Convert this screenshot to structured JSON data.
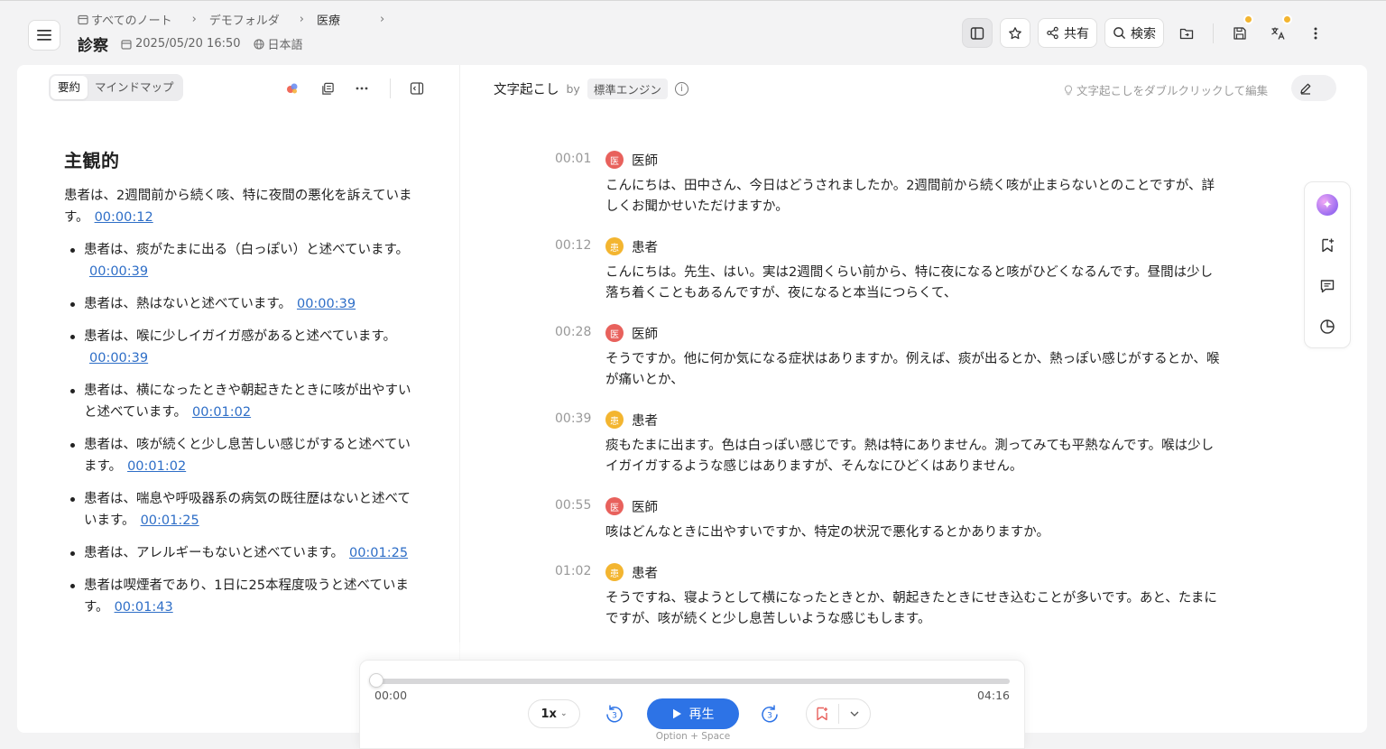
{
  "header": {
    "breadcrumb": [
      "すべてのノート",
      "デモフォルダ",
      "医療"
    ],
    "title": "診察",
    "datetime": "2025/05/20 16:50",
    "language": "日本語",
    "share_label": "共有",
    "search_label": "検索"
  },
  "left_panel": {
    "tabs": [
      "要約",
      "マインドマップ"
    ],
    "active_tab": "要約",
    "section_title": "主観的",
    "intro": {
      "text": "患者は、2週間前から続く咳、特に夜間の悪化を訴えています。",
      "timestamp": "00:00:12"
    },
    "bullets": [
      {
        "text": "患者は、痰がたまに出る（白っぽい）と述べています。",
        "timestamp": "00:00:39"
      },
      {
        "text": "患者は、熱はないと述べています。",
        "timestamp": "00:00:39"
      },
      {
        "text": "患者は、喉に少しイガイガ感があると述べています。",
        "timestamp": "00:00:39"
      },
      {
        "text": "患者は、横になったときや朝起きたときに咳が出やすいと述べています。",
        "timestamp": "00:01:02"
      },
      {
        "text": "患者は、咳が続くと少し息苦しい感じがすると述べています。",
        "timestamp": "00:01:02"
      },
      {
        "text": "患者は、喘息や呼吸器系の病気の既往歴はないと述べています。",
        "timestamp": "00:01:25"
      },
      {
        "text": "患者は、アレルギーもないと述べています。",
        "timestamp": "00:01:25"
      },
      {
        "text": "患者は喫煙者であり、1日に25本程度吸うと述べています。",
        "timestamp": "00:01:43"
      }
    ]
  },
  "transcript": {
    "title": "文字起こし",
    "by": "by",
    "engine": "標準エンジン",
    "hint": "文字起こしをダブルクリックして編集",
    "utterances": [
      {
        "time": "00:01",
        "speaker": "医師",
        "avatar": "医",
        "role": "doctor",
        "text": "こんにちは、田中さん、今日はどうされましたか。2週間前から続く咳が止まらないとのことですが、詳しくお聞かせいただけますか。"
      },
      {
        "time": "00:12",
        "speaker": "患者",
        "avatar": "患",
        "role": "patient",
        "text": "こんにちは。先生、はい。実は2週間くらい前から、特に夜になると咳がひどくなるんです。昼間は少し落ち着くこともあるんですが、夜になると本当につらくて、"
      },
      {
        "time": "00:28",
        "speaker": "医師",
        "avatar": "医",
        "role": "doctor",
        "text": "そうですか。他に何か気になる症状はありますか。例えば、痰が出るとか、熱っぽい感じがするとか、喉が痛いとか、"
      },
      {
        "time": "00:39",
        "speaker": "患者",
        "avatar": "患",
        "role": "patient",
        "text": "痰もたまに出ます。色は白っぽい感じです。熱は特にありません。測ってみても平熱なんです。喉は少しイガイガするような感じはありますが、そんなにひどくはありません。"
      },
      {
        "time": "00:55",
        "speaker": "医師",
        "avatar": "医",
        "role": "doctor",
        "text": "咳はどんなときに出やすいですか、特定の状況で悪化するとかありますか。"
      },
      {
        "time": "01:02",
        "speaker": "患者",
        "avatar": "患",
        "role": "patient",
        "text": "そうですね、寝ようとして横になったときとか、朝起きたときにせき込むことが多いです。あと、たまにですが、咳が続くと少し息苦しいような感じもします。"
      }
    ]
  },
  "player": {
    "current": "00:00",
    "duration": "04:16",
    "progress": 0.0,
    "speed": "1x",
    "skip_back": "3",
    "skip_forward": "3",
    "play_label": "再生",
    "shortcut": "Option + Space"
  },
  "colors": {
    "accent": "#2d73e6",
    "doctor_avatar": "#e8615c",
    "patient_avatar": "#f3b530",
    "link": "#2e6ec7"
  }
}
